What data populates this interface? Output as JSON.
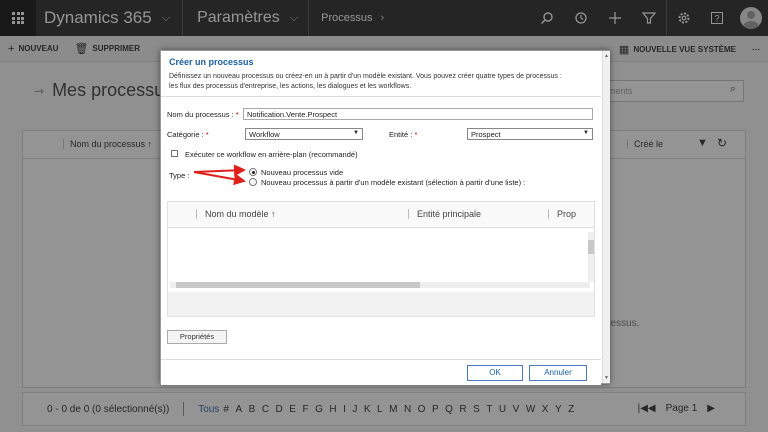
{
  "topbar": {
    "app_name": "Dynamics 365",
    "area_name": "Paramètres",
    "breadcrumb": "Processus",
    "icons": [
      "search-icon",
      "history-icon",
      "plus-icon",
      "filter-icon",
      "gear-icon",
      "help-icon",
      "avatar"
    ]
  },
  "commands": {
    "new": "NOUVEAU",
    "delete": "SUPPRIMER",
    "new_system_view": "NOUVELLE VUE SYSTÈME",
    "more": "⋯"
  },
  "page": {
    "title": "Mes processus",
    "search_placeholder": "ements",
    "grid_col_name": "Nom du processus ↑",
    "grid_col_created": "Créé le",
    "empty_text_fragment": "ocessus."
  },
  "footer": {
    "count": "0 - 0  de 0 (0 sélectionné(s))",
    "all": "Tous",
    "letters": [
      "#",
      "A",
      "B",
      "C",
      "D",
      "E",
      "F",
      "G",
      "H",
      "I",
      "J",
      "K",
      "L",
      "M",
      "N",
      "O",
      "P",
      "Q",
      "R",
      "S",
      "T",
      "U",
      "V",
      "W",
      "X",
      "Y",
      "Z"
    ],
    "page": "Page 1"
  },
  "dialog": {
    "title": "Créer un processus",
    "description": "Définissez un nouveau processus ou créez-en un à partir d'un modèle existant. Vous pouvez créer quatre types de processus : les flux des processus d'entreprise, les actions, les dialogues et les workflows.",
    "process_name_label": "Nom du processus :",
    "process_name_value": "Notification.Vente.Prospect",
    "category_label": "Catégorie :",
    "category_value": "Workflow",
    "entity_label": "Entité :",
    "entity_value": "Prospect",
    "background_checkbox_label": "Exécuter ce workflow en arrière-plan (recommandé)",
    "background_checked": false,
    "type_label": "Type :",
    "type_option_new": "Nouveau processus vide",
    "type_option_template": "Nouveau processus à partir d'un modèle existant (sélection à partir d'une liste) :",
    "type_selected": "new",
    "template_grid": {
      "col_model": "Nom du modèle ↑",
      "col_entity": "Entité principale",
      "col_prop": "Prop"
    },
    "properties_button": "Propriétés",
    "ok_button": "OK",
    "cancel_button": "Annuler"
  },
  "colors": {
    "topbar": "#404040",
    "accent_blue": "#1a5fa6",
    "annotation_arrow": "#e0201b"
  }
}
